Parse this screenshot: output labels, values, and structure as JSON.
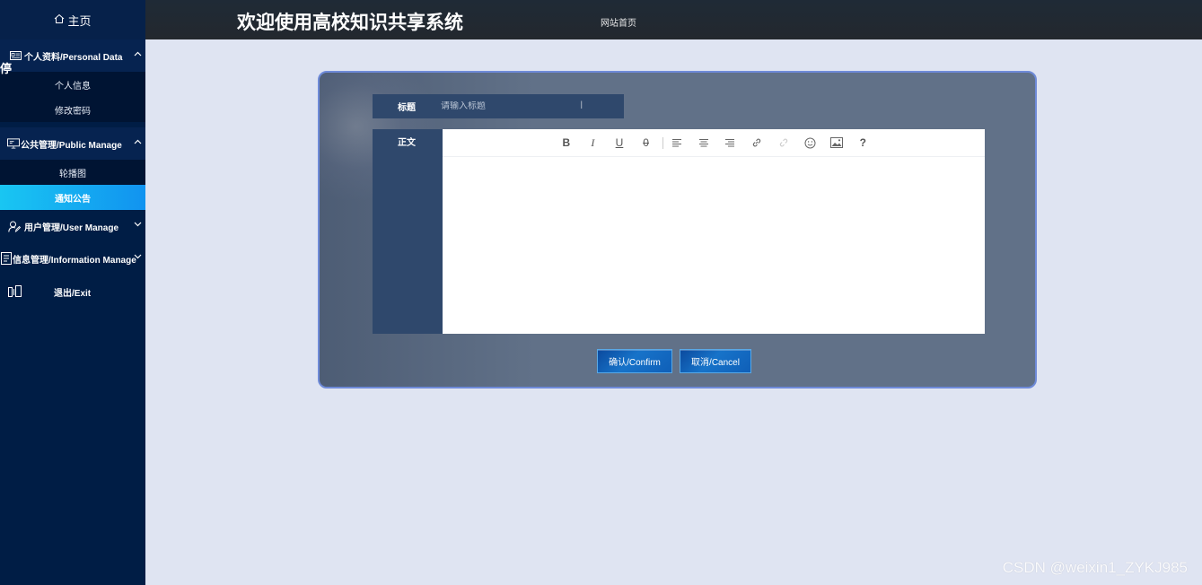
{
  "sidebar": {
    "home_icon": "house-icon",
    "home_label": "主页",
    "overlay_label": "停",
    "groups": [
      {
        "icon": "id-card-icon",
        "label": "个人资料/Personal Data",
        "expanded": true,
        "items": [
          {
            "label": "个人信息"
          },
          {
            "label": "修改密码"
          }
        ]
      },
      {
        "icon": "monitor-icon",
        "label": "公共管理/Public Manage",
        "expanded": true,
        "items": [
          {
            "label": "轮播图"
          },
          {
            "label": "通知公告",
            "active": true
          }
        ]
      },
      {
        "icon": "user-edit-icon",
        "label": "用户管理/User Manage",
        "expanded": false
      },
      {
        "icon": "info-list-icon",
        "label": "信息管理/Information Manage",
        "expanded": false
      }
    ],
    "exit": {
      "icon": "exit-door-icon",
      "label": "退出/Exit"
    }
  },
  "header": {
    "title": "欢迎使用高校知识共享系统",
    "site_link": "网站首页"
  },
  "form": {
    "title_label": "标题",
    "title_placeholder": "请输入标题",
    "title_value": "",
    "body_label": "正文",
    "toolbar": {
      "bold": "B",
      "italic": "I",
      "underline": "U",
      "strike": "0",
      "help": "?"
    },
    "confirm_label": "确认/Confirm",
    "cancel_label": "取消/Cancel"
  },
  "colors": {
    "sidebar_bg": "#001d45",
    "active_item": "#19c6f2",
    "header_bg": "#23282e",
    "page_bg": "#dfe4f2",
    "panel_bg": "#5f7089",
    "field_bg": "#2f486c"
  },
  "watermark": "CSDN @weixin1_ZYKJ985"
}
